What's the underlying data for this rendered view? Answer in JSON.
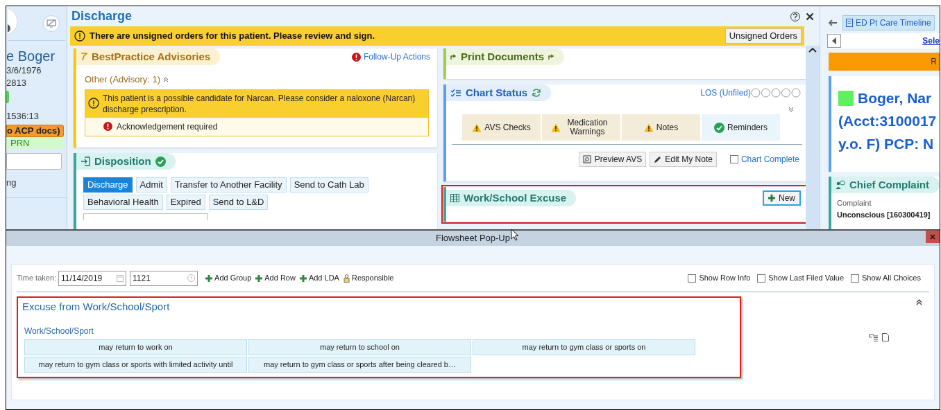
{
  "sidebar": {
    "name": "e Boger",
    "dob": "3/6/1976",
    "mrn": "2813",
    "time": "1536:13",
    "acp_badge": "o ACP docs)",
    "code_badge": "PRN",
    "note": "ng"
  },
  "discharge": {
    "title": "Discharge",
    "banner": "There are unsigned orders for this patient. Please review and sign.",
    "unsigned_button": "Unsigned Orders",
    "bpa": {
      "title": "BestPractice Advisories",
      "follow_up": "Follow-Up Actions",
      "group": "Other (Advisory: 1)",
      "message": "This patient is a possible candidate for Narcan. Please consider a naloxone (Narcan) discharge prescription.",
      "ack": "Acknowledgement required"
    },
    "disposition": {
      "title": "Disposition",
      "complete": true,
      "options": [
        {
          "label": "Discharge",
          "selected": true
        },
        {
          "label": "Admit",
          "selected": false
        },
        {
          "label": "Transfer to Another Facility",
          "selected": false
        },
        {
          "label": "Send to Cath Lab",
          "selected": false
        },
        {
          "label": "Behavioral Health",
          "selected": false
        },
        {
          "label": "Expired",
          "selected": false
        },
        {
          "label": "Send to L&D",
          "selected": false
        }
      ]
    },
    "print": {
      "title": "Print Documents"
    },
    "chart_status": {
      "title": "Chart Status",
      "los": "LOS (Unfiled)",
      "checks": [
        {
          "label": "AVS Checks",
          "kind": "warning"
        },
        {
          "label": "Medication Warnings",
          "kind": "warning"
        },
        {
          "label": "Notes",
          "kind": "warning"
        },
        {
          "label": "Reminders",
          "kind": "ok"
        }
      ],
      "preview_button": "Preview AVS",
      "edit_button": "Edit My Note",
      "chart_complete": {
        "label": "Chart Complete",
        "checked": false
      }
    },
    "work_excuse": {
      "title": "Work/School Excuse",
      "new_button": "New"
    }
  },
  "right_panel": {
    "tab": "ED Pt Care Timeline",
    "link": "Sele",
    "orange_bar": "R",
    "patient_lines": [
      "Boger, Nar",
      "(Acct:3100017",
      "y.o. F) PCP: N"
    ],
    "chief_complaint": {
      "title": "Chief Complaint",
      "label": "Complaint",
      "value": "Unconscious [160300419]"
    }
  },
  "popup": {
    "title": "Flowsheet Pop-Up",
    "time_label": "Time taken:",
    "date": "11/14/2019",
    "time": "1121",
    "actions": [
      {
        "label": "Add Group",
        "kind": "add"
      },
      {
        "label": "Add Row",
        "kind": "add"
      },
      {
        "label": "Add LDA",
        "kind": "add"
      },
      {
        "label": "Responsible",
        "kind": "person"
      }
    ],
    "options": [
      {
        "label": "Show Row Info",
        "checked": false
      },
      {
        "label": "Show Last Filed Value",
        "checked": false
      },
      {
        "label": "Show All Choices",
        "checked": false
      }
    ],
    "group": {
      "title": "Excuse from Work/School/Sport",
      "row_label": "Work/School/Sport",
      "choices": [
        "may return to work on",
        "may return to school on",
        "may return to gym class or sports on",
        "may return to gym class or sports with limited activity until",
        "may return to gym class or sports after being cleared b…"
      ]
    }
  }
}
